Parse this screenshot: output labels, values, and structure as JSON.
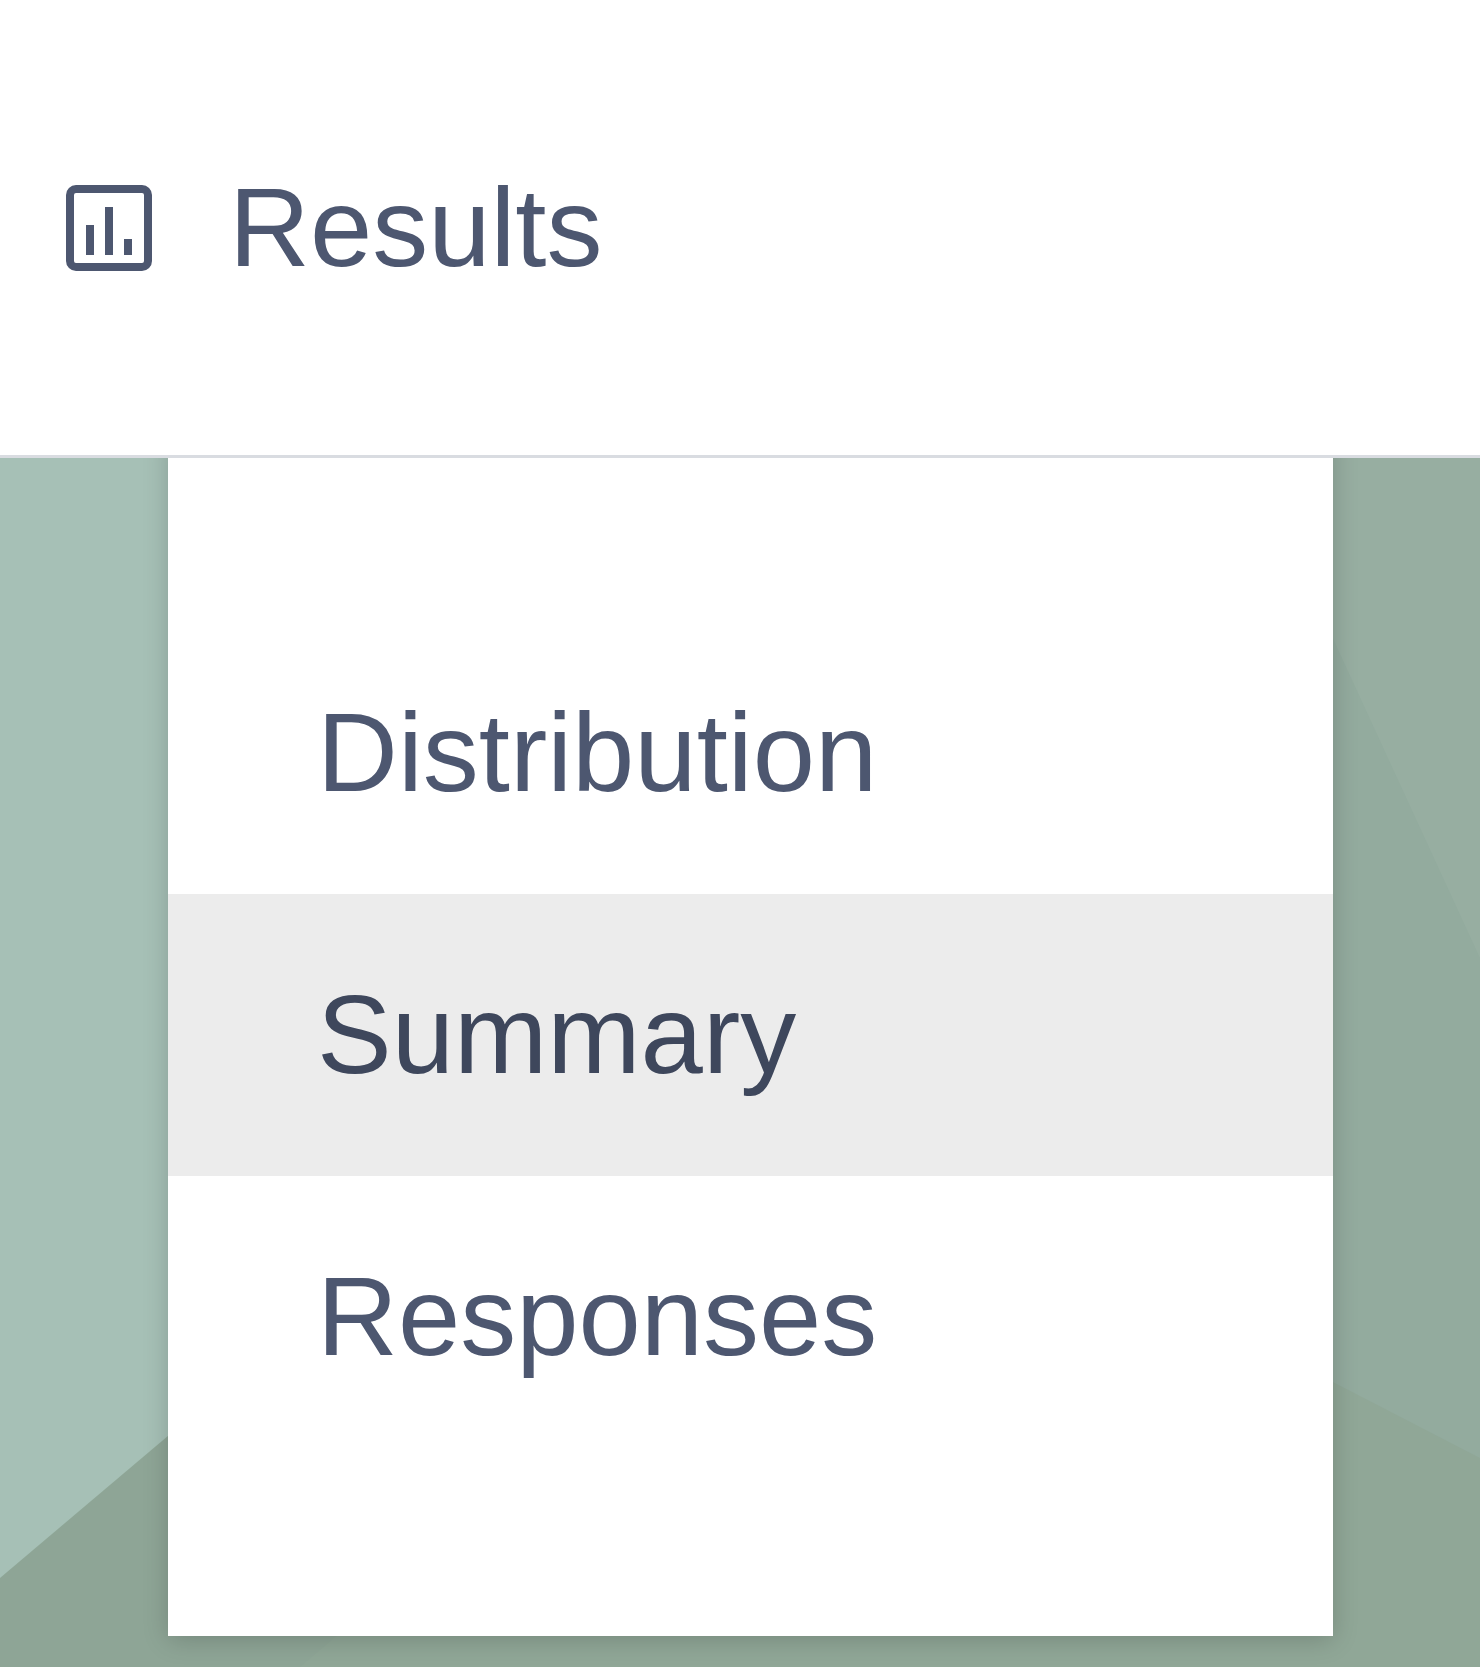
{
  "header": {
    "title": "Results"
  },
  "menu": {
    "items": [
      {
        "label": "Distribution",
        "selected": false
      },
      {
        "label": "Summary",
        "selected": true
      },
      {
        "label": "Responses",
        "selected": false
      }
    ]
  }
}
